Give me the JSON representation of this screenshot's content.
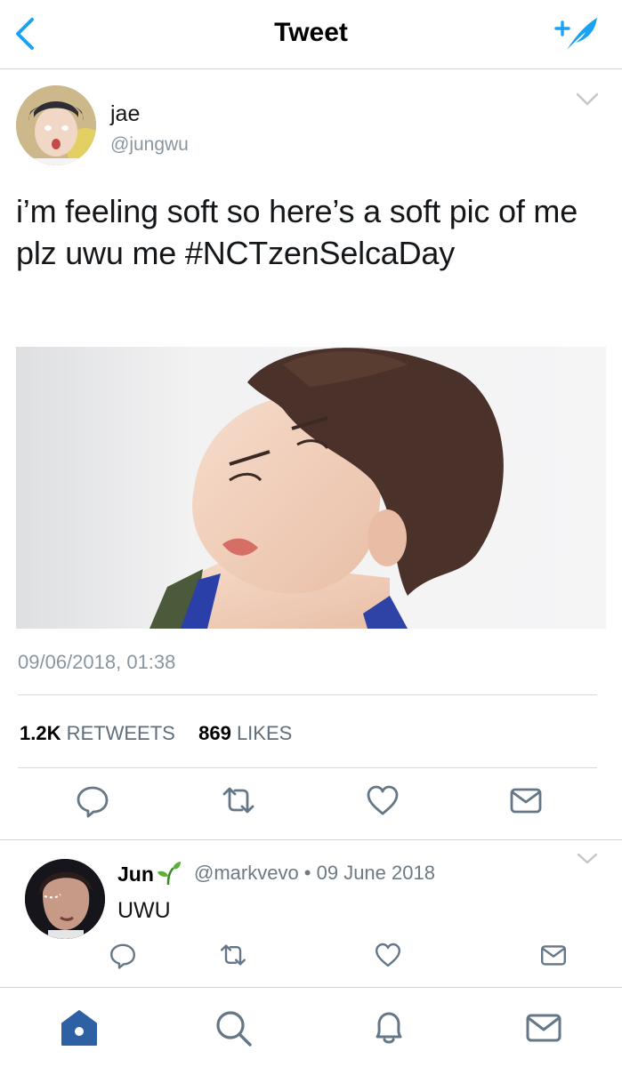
{
  "header": {
    "title": "Tweet",
    "back_icon": "chevron-left-icon",
    "compose_icon": "compose-tweet-icon"
  },
  "tweet": {
    "author_name": "jae",
    "author_handle": "@jungwu",
    "text": "i’m feeling soft so here’s a soft pic of me plz uwu me #NCTzenSelcaDay",
    "timestamp": "09/06/2018, 01:38",
    "retweet_count": "1.2K",
    "retweet_label": "RETWEETS",
    "like_count": "869",
    "like_label": "LIKES",
    "actions": [
      "reply-icon",
      "retweet-icon",
      "like-icon",
      "direct-message-icon"
    ]
  },
  "reply": {
    "author_name": "Jun",
    "handle_and_date": "@markvevo • 09 June 2018",
    "text": "UWU"
  },
  "tabbar": {
    "items": [
      "home-icon",
      "search-icon",
      "notifications-icon",
      "messages-icon"
    ]
  },
  "colors": {
    "accent": "#1da1f2",
    "icon_gray": "#657786",
    "home_active": "#2e60a4"
  }
}
